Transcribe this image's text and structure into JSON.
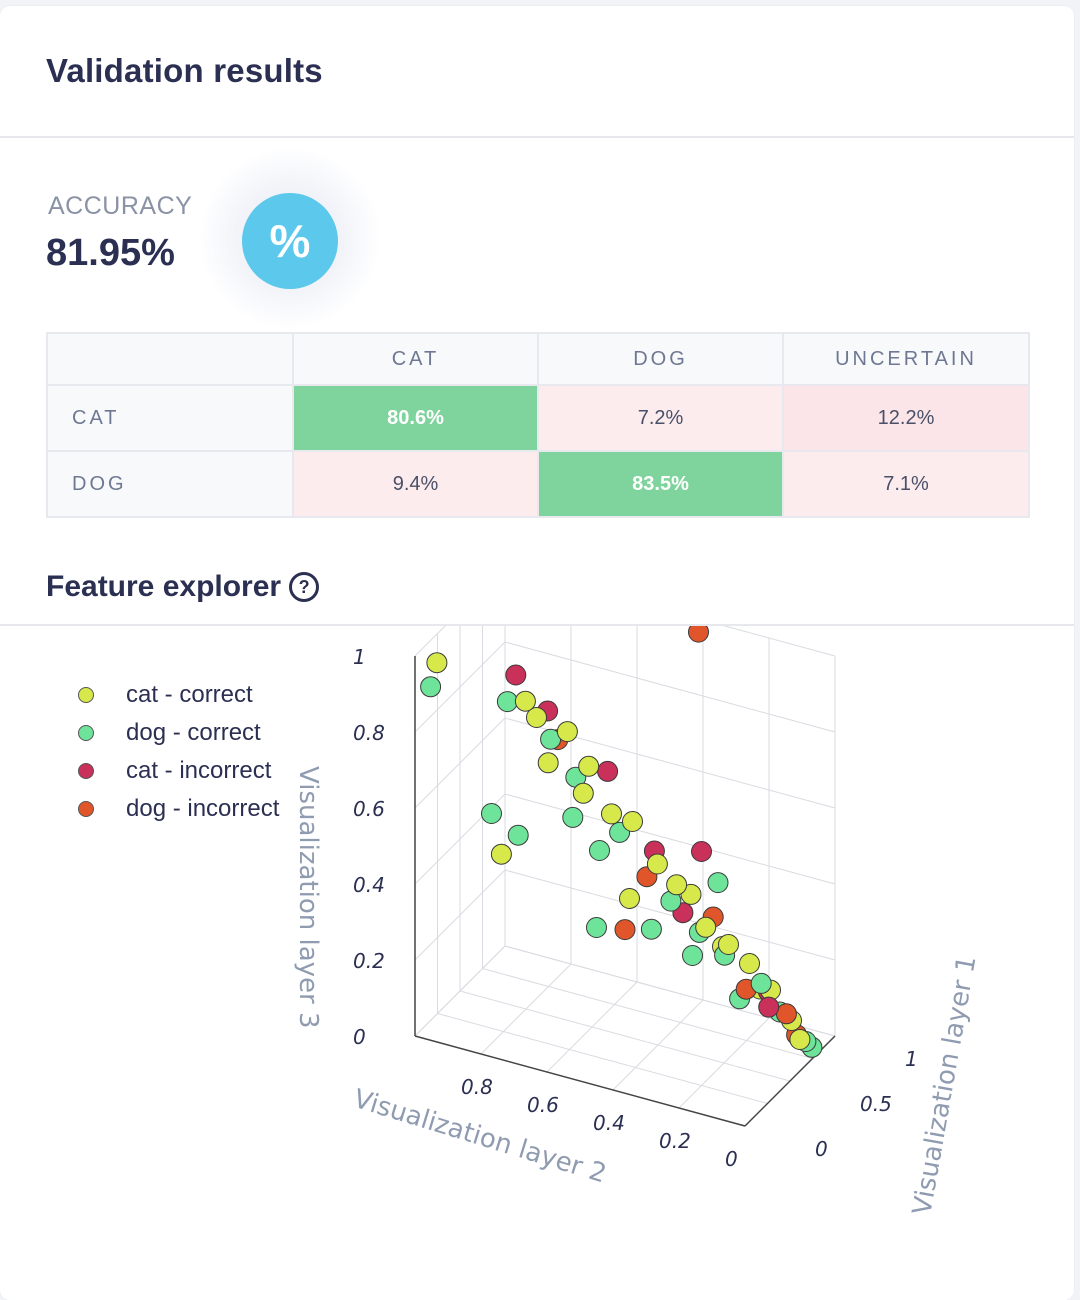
{
  "header": {
    "title": "Validation results"
  },
  "accuracy": {
    "label": "ACCURACY",
    "value": "81.95%",
    "icon": "percent-icon",
    "icon_glyph": "%"
  },
  "confusion_matrix": {
    "columns": [
      "CAT",
      "DOG",
      "UNCERTAIN"
    ],
    "rows": [
      {
        "label": "CAT",
        "cells": [
          "80.6%",
          "7.2%",
          "12.2%"
        ]
      },
      {
        "label": "DOG",
        "cells": [
          "9.4%",
          "83.5%",
          "7.1%"
        ]
      }
    ]
  },
  "feature_explorer": {
    "title": "Feature explorer",
    "help_icon": "question-circle-icon",
    "legend": [
      {
        "label": "cat - correct",
        "color": "#d6e84a"
      },
      {
        "label": "dog - correct",
        "color": "#6ee39a"
      },
      {
        "label": "cat - incorrect",
        "color": "#c9305a"
      },
      {
        "label": "dog - incorrect",
        "color": "#e0562a"
      }
    ]
  },
  "chart_data": {
    "type": "scatter",
    "subtype": "3d",
    "axis_titles": {
      "x": "Visualization layer 1",
      "y": "Visualization layer 2",
      "z": "Visualization layer 3"
    },
    "x_ticks": [
      "0",
      "0.5",
      "1"
    ],
    "y_ticks": [
      "0",
      "0.2",
      "0.4",
      "0.6",
      "0.8"
    ],
    "z_ticks": [
      "0",
      "0.2",
      "0.4",
      "0.6",
      "0.8",
      "1"
    ],
    "grid": true,
    "legend_placement": "top-left",
    "series": [
      {
        "name": "cat - correct",
        "color": "#d6e84a",
        "points": [
          [
            0.06,
            0.95,
            0.98
          ],
          [
            0.2,
            0.72,
            0.9
          ],
          [
            0.25,
            0.7,
            0.85
          ],
          [
            0.3,
            0.62,
            0.82
          ],
          [
            0.28,
            0.55,
            0.75
          ],
          [
            0.35,
            0.5,
            0.62
          ],
          [
            0.4,
            0.45,
            0.6
          ],
          [
            0.42,
            0.38,
            0.5
          ],
          [
            0.45,
            0.33,
            0.45
          ],
          [
            0.5,
            0.3,
            0.42
          ],
          [
            0.48,
            0.25,
            0.35
          ],
          [
            0.55,
            0.2,
            0.3
          ],
          [
            0.6,
            0.15,
            0.25
          ],
          [
            0.65,
            0.1,
            0.18
          ],
          [
            0.7,
            0.05,
            0.1
          ],
          [
            0.72,
            0.03,
            0.05
          ],
          [
            0.3,
            0.82,
            0.45
          ],
          [
            0.55,
            0.5,
            0.35
          ],
          [
            0.85,
            0.3,
            0.2
          ],
          [
            0.9,
            0.2,
            0.1
          ],
          [
            0.38,
            0.7,
            0.7
          ],
          [
            0.33,
            0.58,
            0.66
          ]
        ]
      },
      {
        "name": "dog - correct",
        "color": "#6ee39a",
        "points": [
          [
            0.1,
            0.98,
            0.9
          ],
          [
            0.22,
            0.78,
            0.88
          ],
          [
            0.26,
            0.66,
            0.8
          ],
          [
            0.32,
            0.6,
            0.7
          ],
          [
            0.3,
            0.85,
            0.55
          ],
          [
            0.34,
            0.78,
            0.5
          ],
          [
            0.4,
            0.55,
            0.5
          ],
          [
            0.46,
            0.35,
            0.4
          ],
          [
            0.52,
            0.28,
            0.32
          ],
          [
            0.58,
            0.22,
            0.26
          ],
          [
            0.62,
            0.12,
            0.2
          ],
          [
            0.68,
            0.08,
            0.12
          ],
          [
            0.75,
            0.02,
            0.04
          ],
          [
            0.78,
            0.01,
            0.02
          ],
          [
            0.55,
            0.6,
            0.25
          ],
          [
            0.7,
            0.35,
            0.2
          ],
          [
            0.8,
            0.3,
            0.38
          ],
          [
            0.5,
            0.42,
            0.3
          ],
          [
            0.44,
            0.5,
            0.55
          ],
          [
            0.36,
            0.62,
            0.58
          ],
          [
            0.6,
            0.18,
            0.15
          ]
        ]
      },
      {
        "name": "cat - incorrect",
        "color": "#c9305a",
        "points": [
          [
            0.24,
            0.76,
            0.95
          ],
          [
            0.3,
            0.68,
            0.86
          ],
          [
            0.38,
            0.52,
            0.72
          ],
          [
            0.46,
            0.4,
            0.52
          ],
          [
            0.52,
            0.33,
            0.36
          ],
          [
            0.8,
            0.35,
            0.45
          ],
          [
            0.7,
            0.12,
            0.16
          ],
          [
            0.63,
            0.1,
            0.14
          ]
        ]
      },
      {
        "name": "dog - incorrect",
        "color": "#e0562a",
        "points": [
          [
            0.95,
            0.4,
            0.98
          ],
          [
            0.34,
            0.66,
            0.78
          ],
          [
            0.45,
            0.42,
            0.45
          ],
          [
            0.5,
            0.5,
            0.28
          ],
          [
            0.82,
            0.32,
            0.28
          ],
          [
            0.68,
            0.06,
            0.12
          ],
          [
            0.6,
            0.16,
            0.18
          ],
          [
            0.72,
            0.04,
            0.06
          ]
        ]
      }
    ]
  }
}
